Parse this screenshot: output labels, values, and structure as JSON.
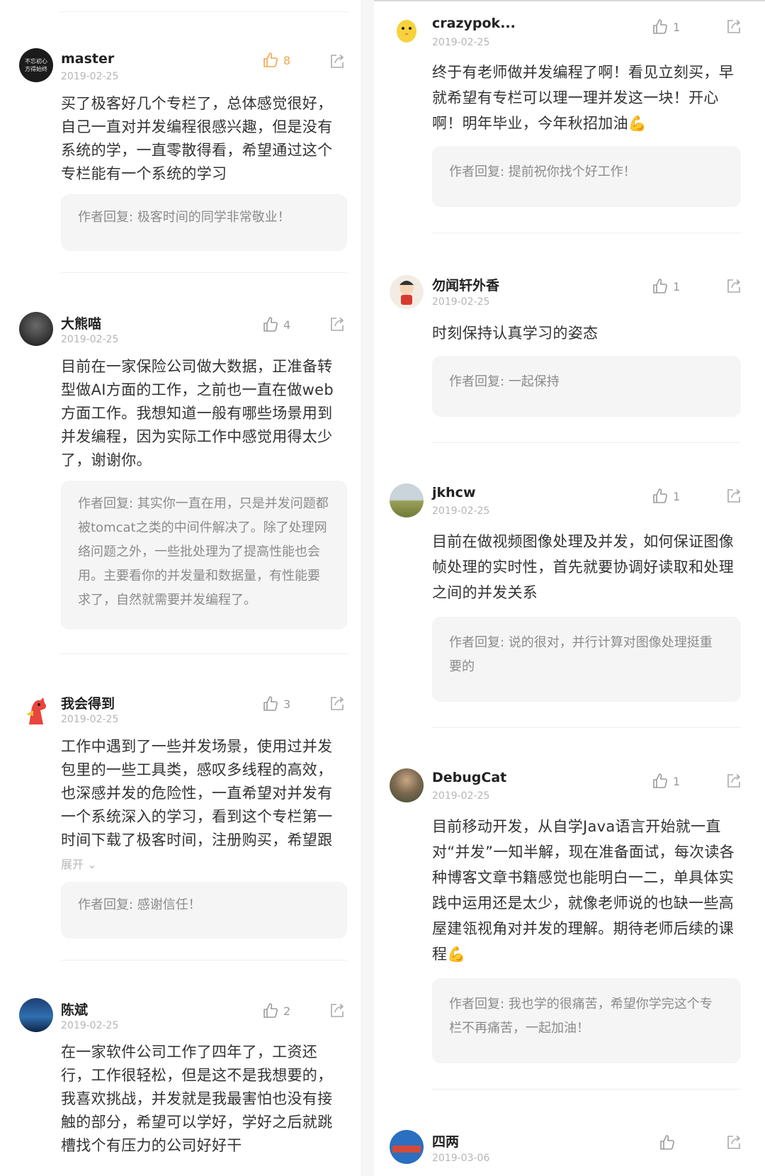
{
  "colors": {
    "accent_like": "#f0a64b",
    "reply_bg": "#f5f5f6"
  },
  "left": [
    {
      "user": "master",
      "date": "2019-02-25",
      "likes": "8",
      "text": "买了极客好几个专栏了，总体感觉很好，自己一直对并发编程很感兴趣，但是没有系统的学，一直零散得看，希望通过这个专栏能有一个系统的学习",
      "reply": "作者回复: 极客时间的同学非常敬业！"
    },
    {
      "user": "大熊喵",
      "date": "2019-02-25",
      "likes": "4",
      "text": "目前在一家保险公司做大数据，正准备转型做AI方面的工作，之前也一直在做web方面工作。我想知道一般有哪些场景用到并发编程，因为实际工作中感觉用得太少了，谢谢你。",
      "reply": "作者回复: 其实你一直在用，只是并发问题都被tomcat之类的中间件解决了。除了处理网络问题之外，一些批处理为了提高性能也会用。主要看你的并发量和数据量，有性能要求了，自然就需要并发编程了。"
    },
    {
      "user": "我会得到",
      "date": "2019-02-25",
      "likes": "3",
      "text": "工作中遇到了一些并发场景，使用过并发包里的一些工具类，感叹多线程的高效，也深感并发的危险性，一直希望对并发有一个系统深入的学习，看到这个专栏第一时间下载了极客时间，注册购买，希望跟令哥一起…",
      "expand": "展开",
      "reply": "作者回复: 感谢信任！"
    },
    {
      "user": "陈斌",
      "date": "2019-02-25",
      "likes": "2",
      "text": "在一家软件公司工作了四年了，工资还行，工作很轻松，但是这不是我想要的，我喜欢挑战，并发就是我最害怕也没有接触的部分，希望可以学好，学好之后就跳槽找个有压力的公司好好干"
    }
  ],
  "right": [
    {
      "user": "crazypok...",
      "date": "2019-02-25",
      "likes": "1",
      "text": "终于有老师做并发编程了啊！看见立刻买，早就希望有专栏可以理一理并发这一块！开心啊！明年毕业，今年秋招加油💪",
      "reply": "作者回复: 提前祝你找个好工作！"
    },
    {
      "user": "勿闻轩外香",
      "date": "2019-02-25",
      "likes": "1",
      "text": "时刻保持认真学习的姿态",
      "reply": "作者回复: 一起保持"
    },
    {
      "user": "jkhcw",
      "date": "2019-02-25",
      "likes": "1",
      "text": "目前在做视频图像处理及并发，如何保证图像帧处理的实时性，首先就要协调好读取和处理之间的并发关系",
      "reply": "作者回复: 说的很对，并行计算对图像处理挺重要的"
    },
    {
      "user": "DebugCat",
      "date": "2019-02-25",
      "likes": "1",
      "text": "目前移动开发，从自学Java语言开始就一直对“并发”一知半解，现在准备面试，每次读各种博客文章书籍感觉也能明白一二，单具体实践中运用还是太少，就像老师说的也缺一些高屋建瓴视角对并发的理解。期待老师后续的课程💪",
      "reply": "作者回复: 我也学的很痛苦，希望你学完这个专栏不再痛苦，一起加油！"
    },
    {
      "user": "四两",
      "date": "2019-03-06",
      "likes": ""
    }
  ]
}
